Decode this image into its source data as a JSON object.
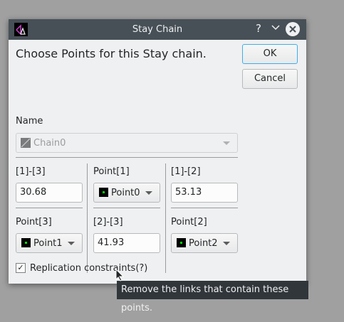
{
  "window": {
    "title": "Stay Chain",
    "help_label": "?"
  },
  "heading": "Choose Points for this Stay chain.",
  "buttons": {
    "ok": "OK",
    "cancel": "Cancel"
  },
  "name_section": {
    "label": "Name",
    "value": "Chain0"
  },
  "grid": {
    "r1c1": {
      "label": "[1]-[3]",
      "value": "30.68"
    },
    "r1c2": {
      "label": "Point[1]",
      "value": "Point0"
    },
    "r1c3": {
      "label": "[1]-[2]",
      "value": "53.13"
    },
    "r2c1": {
      "label": "Point[3]",
      "value": "Point1"
    },
    "r2c2": {
      "label": "[2]-[3]",
      "value": "41.93"
    },
    "r2c3": {
      "label": "Point[2]",
      "value": "Point2"
    }
  },
  "replication": {
    "label": "Replication constraints(?)",
    "checked": true,
    "check_mark": "✓"
  },
  "tooltip": "Remove the links that contain these points.",
  "colors": {
    "titlebar": "#475057",
    "focus": "#3daee9",
    "point_marker": "#00e000"
  }
}
